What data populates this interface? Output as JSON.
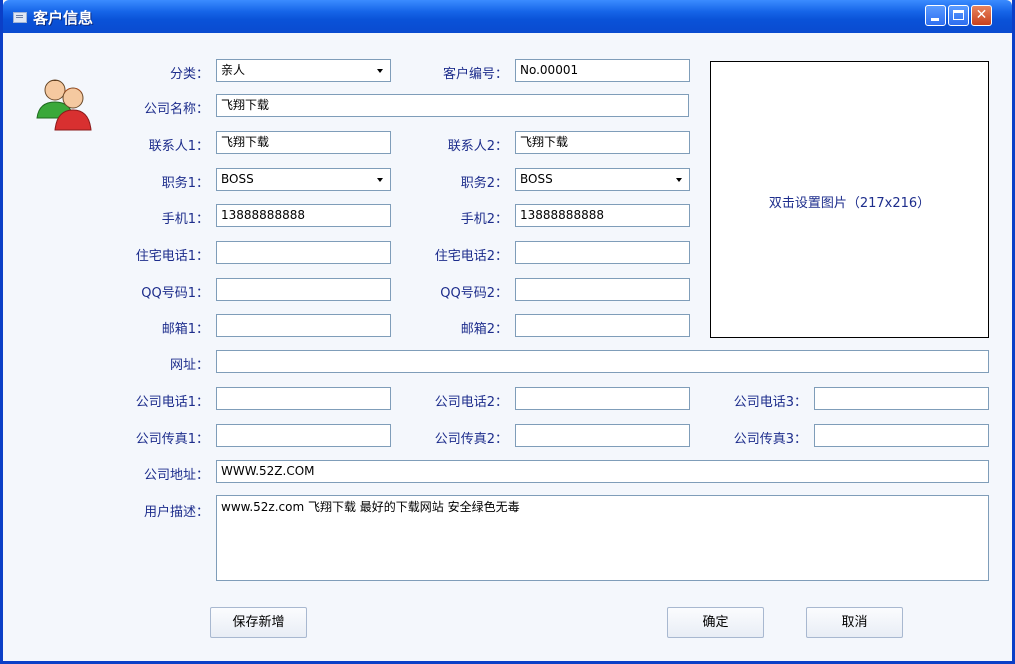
{
  "window": {
    "title": "客户信息"
  },
  "labels": {
    "category": "分类：",
    "customer_no": "客户编号：",
    "company_name": "公司名称：",
    "contact1": "联系人1：",
    "contact2": "联系人2：",
    "position1": "职务1：",
    "position2": "职务2：",
    "mobile1": "手机1：",
    "mobile2": "手机2：",
    "home_phone1": "住宅电话1：",
    "home_phone2": "住宅电话2：",
    "qq1": "QQ号码1：",
    "qq2": "QQ号码2：",
    "email1": "邮箱1：",
    "email2": "邮箱2：",
    "website": "网址：",
    "company_phone1": "公司电话1：",
    "company_phone2": "公司电话2：",
    "company_phone3": "公司电话3：",
    "company_fax1": "公司传真1：",
    "company_fax2": "公司传真2：",
    "company_fax3": "公司传真3：",
    "company_address": "公司地址：",
    "user_description": "用户描述："
  },
  "values": {
    "category": "亲人",
    "customer_no": "No.00001",
    "company_name": "飞翔下载",
    "contact1": "飞翔下载",
    "contact2": "飞翔下载",
    "position1": "BOSS",
    "position2": "BOSS",
    "mobile1": "13888888888",
    "mobile2": "13888888888",
    "home_phone1": "",
    "home_phone2": "",
    "qq1": "",
    "qq2": "",
    "email1": "",
    "email2": "",
    "website": "",
    "company_phone1": "",
    "company_phone2": "",
    "company_phone3": "",
    "company_fax1": "",
    "company_fax2": "",
    "company_fax3": "",
    "company_address": "WWW.52Z.COM",
    "user_description": "www.52z.com 飞翔下载 最好的下载网站 安全绿色无毒"
  },
  "photo": {
    "hint": "双击设置图片（217x216）"
  },
  "buttons": {
    "save_new": "保存新增",
    "ok": "确定",
    "cancel": "取消"
  },
  "icons": {
    "window": "window-icon",
    "avatar": "users-icon",
    "dropdown": "dropdown-arrow-icon"
  },
  "colors": {
    "titlebar": "#0a52d8",
    "label": "#1d2d8c",
    "field_border": "#7f9db9"
  }
}
